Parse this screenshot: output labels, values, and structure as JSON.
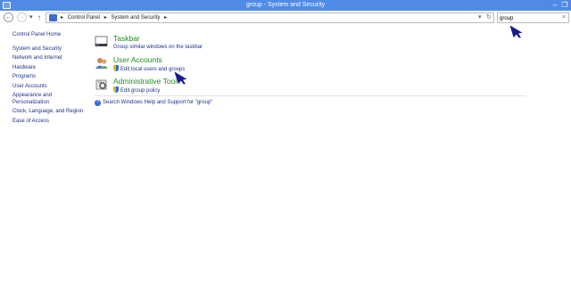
{
  "window": {
    "title": "group - System and Security",
    "minimize": "–",
    "restore": "❐"
  },
  "nav": {
    "back": "←",
    "forward": "→",
    "recent": "▾",
    "up": "↑",
    "breadcrumbs": [
      "Control Panel",
      "System and Security"
    ],
    "separator": "▸",
    "refresh": "↻"
  },
  "search": {
    "value": "group",
    "clear": "×"
  },
  "sidebar": {
    "items": [
      {
        "label": "Control Panel Home"
      },
      {
        "label": "System and Security"
      },
      {
        "label": "Network and Internet"
      },
      {
        "label": "Hardware"
      },
      {
        "label": "Programs"
      },
      {
        "label": "User Accounts"
      },
      {
        "label": "Appearance and"
      },
      {
        "label": "Personalization"
      },
      {
        "label": "Clock, Language, and Region"
      },
      {
        "label": "Ease of Access"
      }
    ]
  },
  "results": [
    {
      "heading": "Taskbar",
      "link": "Group similar windows on the taskbar",
      "icon": "taskbar-icon",
      "shield": false
    },
    {
      "heading": "User Accounts",
      "link": "Edit local users and groups",
      "icon": "user-accounts-icon",
      "shield": true
    },
    {
      "heading": "Administrative Tools",
      "link": "Edit group policy",
      "icon": "administrative-tools-icon",
      "shield": true
    }
  ],
  "help": {
    "label": "Search Windows Help and Support for \"group\"",
    "icon": "help-icon"
  },
  "colors": {
    "titlebar": "#4f8ae6",
    "heading": "#1e8a1e",
    "link": "#1e3287",
    "cursor": "#1a1a8c"
  }
}
